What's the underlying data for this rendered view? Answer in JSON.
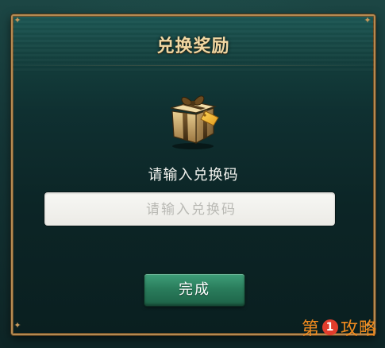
{
  "dialog": {
    "title": "兑换奖励",
    "prompt": "请输入兑换码",
    "input": {
      "value": "",
      "placeholder": "请输入兑换码"
    },
    "done_label": "完成",
    "gift_icon": "gift-box-icon"
  },
  "watermark": {
    "prefix": "第",
    "number": "1",
    "suffix": "攻略"
  },
  "colors": {
    "frame_gold": "#b58a52",
    "title_gold": "#f0d7a3",
    "button_green": "#2a7d5c",
    "watermark_orange": "#f08a1e",
    "watermark_red": "#e23d2c"
  }
}
